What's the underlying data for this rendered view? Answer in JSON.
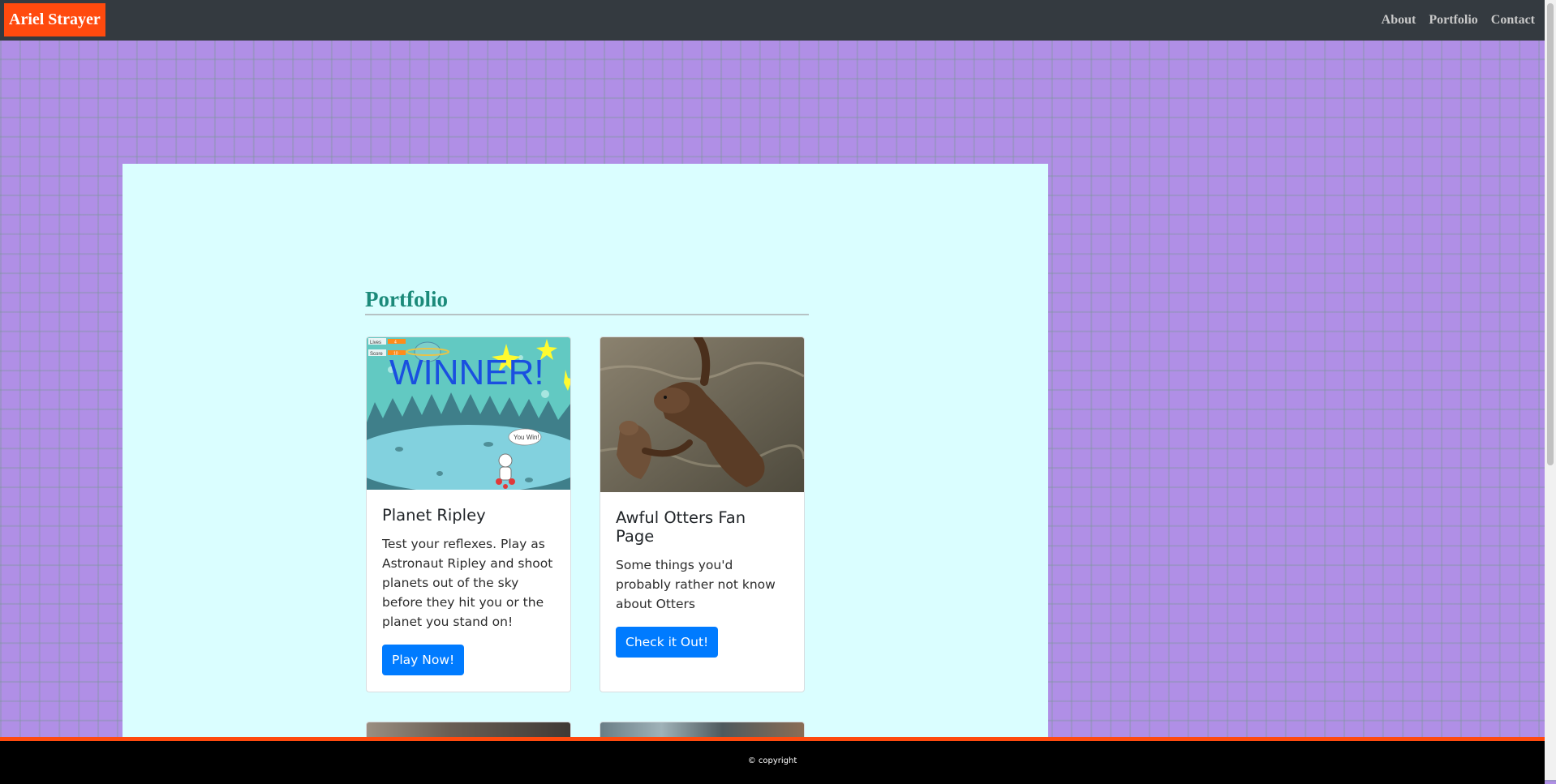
{
  "navbar": {
    "brand": "Ariel Strayer",
    "links": [
      "About",
      "Portfolio",
      "Contact"
    ]
  },
  "main": {
    "section_title": "Portfolio",
    "cards": [
      {
        "title": "Planet Ripley",
        "text": "Test your reflexes. Play as Astronaut Ripley and shoot planets out of the sky before they hit you or the planet you stand on!",
        "button": "Play Now!",
        "image": {
          "banner": "WINNER!",
          "lives_label": "Lives",
          "lives_value": "4",
          "score_label": "Score",
          "score_value": "10",
          "speech": "You Win!"
        }
      },
      {
        "title": "Awful Otters Fan Page",
        "text": "Some things you'd probably rather not know about Otters",
        "button": "Check it Out!"
      }
    ]
  },
  "footer": {
    "text": "© copyright"
  },
  "colors": {
    "brand_bg": "#ff4a0e",
    "navbar_bg": "#343a40",
    "panel_bg": "#dafeff",
    "title_color": "#1b8a7a",
    "button_bg": "#007bff",
    "page_bg": "#b08fe6"
  }
}
